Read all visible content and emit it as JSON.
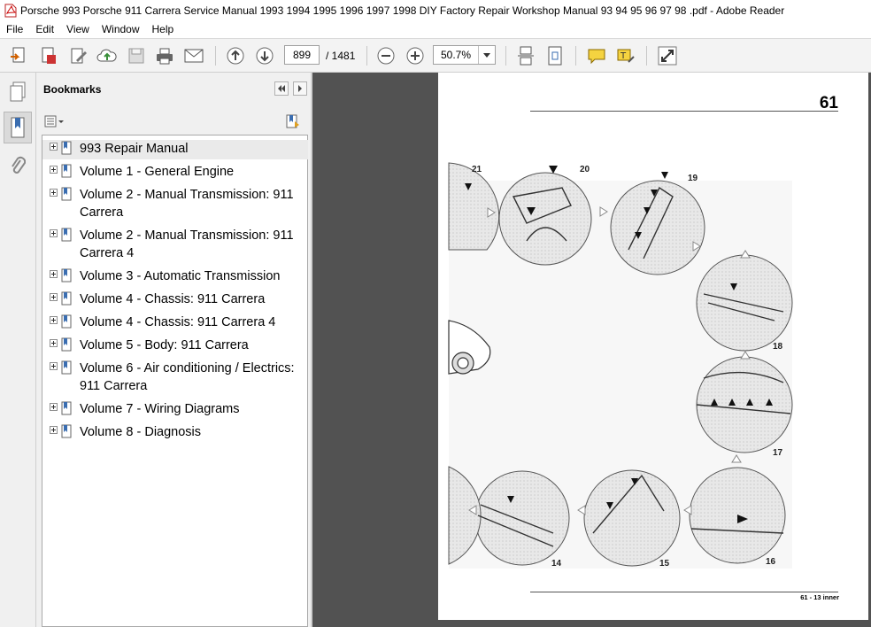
{
  "window": {
    "title": "Porsche 993  Porsche 911 Carrera Service Manual  1993 1994 1995 1996 1997 1998  DIY Factory Repair  Workshop Manual  93 94 95 96 97 98 .pdf - Adobe Reader"
  },
  "menu": [
    "File",
    "Edit",
    "View",
    "Window",
    "Help"
  ],
  "toolbar": {
    "page_current": "899",
    "page_total": "/ 1481",
    "zoom": "50.7%"
  },
  "bookmarks": {
    "header": "Bookmarks",
    "items": [
      {
        "label": "993 Repair Manual"
      },
      {
        "label": "Volume 1 - General Engine"
      },
      {
        "label": "Volume 2 - Manual Transmission: 911 Carrera"
      },
      {
        "label": "Volume 2 - Manual Transmission: 911 Carrera 4"
      },
      {
        "label": "Volume 3 - Automatic Transmission"
      },
      {
        "label": "Volume 4 - Chassis: 911 Carrera"
      },
      {
        "label": "Volume 4 - Chassis: 911 Carrera 4"
      },
      {
        "label": "Volume 5 - Body:  911 Carrera"
      },
      {
        "label": "Volume 6 - Air conditioning / Electrics: 911 Carrera"
      },
      {
        "label": "Volume 7 - Wiring Diagrams"
      },
      {
        "label": "Volume 8 - Diagnosis"
      }
    ]
  },
  "document": {
    "page_number": "61",
    "footer": "61 - 13 inner",
    "figure_labels": [
      "21",
      "20",
      "19",
      "18",
      "17",
      "16",
      "15",
      "14"
    ]
  }
}
